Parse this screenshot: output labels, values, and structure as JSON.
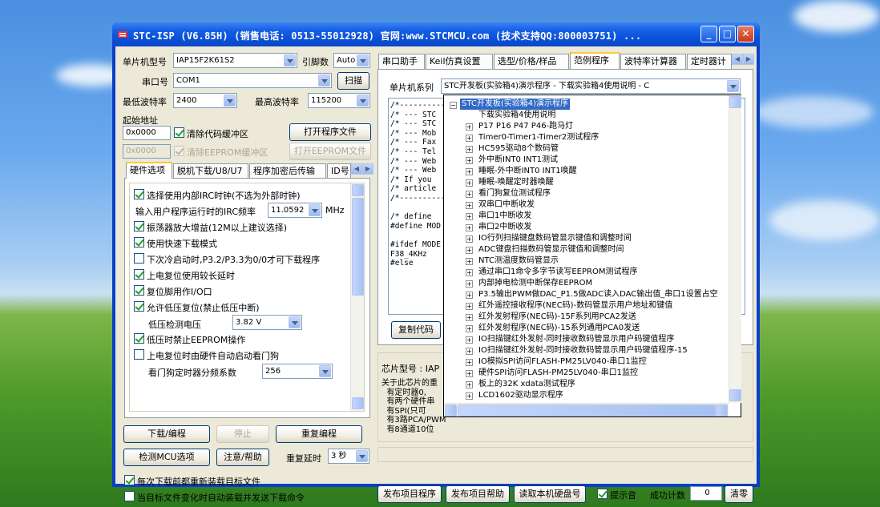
{
  "window": {
    "title": "STC-ISP (V6.85H) (销售电话: 0513-55012928) 官网:www.STCMCU.com  (技术支持QQ:800003751) ..."
  },
  "left": {
    "mcu_label": "单片机型号",
    "mcu_value": "IAP15F2K61S2",
    "pin_label": "引脚数",
    "pin_value": "Auto",
    "port_label": "串口号",
    "port_value": "COM1",
    "scan_button": "扫描",
    "min_baud_label": "最低波特率",
    "min_baud_value": "2400",
    "max_baud_label": "最高波特率",
    "max_baud_value": "115200",
    "start_addr_label": "起始地址",
    "addr1": "0x0000",
    "clear_code_label": "清除代码缓冲区",
    "open_prog_button": "打开程序文件",
    "addr2": "0x0000",
    "clear_eeprom_label": "清除EEPROM缓冲区",
    "open_eeprom_button": "打开EEPROM文件",
    "tabs": [
      "硬件选项",
      "脱机下载/U8/U7",
      "程序加密后传输",
      "ID号"
    ],
    "options": [
      {
        "label": "选择使用内部IRC时钟(不选为外部时钟)",
        "checked": true
      },
      {
        "label": "振荡器放大增益(12M以上建议选择)",
        "checked": true
      },
      {
        "label": "使用快速下载模式",
        "checked": true
      },
      {
        "label": "下次冷启动时,P3.2/P3.3为0/0才可下载程序",
        "checked": false
      },
      {
        "label": "上电复位使用较长延时",
        "checked": true
      },
      {
        "label": "复位脚用作I/O口",
        "checked": true
      },
      {
        "label": "允许低压复位(禁止低压中断)",
        "checked": true
      },
      {
        "label": "低压时禁止EEPROM操作",
        "checked": true
      },
      {
        "label": "上电复位时由硬件自动启动看门狗",
        "checked": false
      }
    ],
    "irc_label": "输入用户程序运行时的IRC频率",
    "irc_value": "11.0592",
    "irc_unit": "MHz",
    "lv_label": "低压检测电压",
    "lv_value": "3.82 V",
    "wd_label": "看门狗定时器分频系数",
    "wd_value": "256",
    "download_button": "下载/编程",
    "stop_button": "停止",
    "reprogram_button": "重复编程",
    "detect_button": "检测MCU选项",
    "help_button": "注意/帮助",
    "delay_label": "重复延时",
    "delay_value": "3 秒",
    "reload_label": "每次下载前都重新装载目标文件",
    "reload_checked": true,
    "autoload_label": "当目标文件变化时自动装载并发送下载命令",
    "autoload_checked": false
  },
  "right": {
    "tabs": [
      "串口助手",
      "Keil仿真设置",
      "选型/价格/样品",
      "范例程序",
      "波特率计算器",
      "定时器计"
    ],
    "series_label": "单片机系列",
    "series_value": "STC开发板(实验箱4)演示程序 - 下载实验箱4使用说明 - C",
    "code_lines": [
      "/*------------",
      "/* --- STC",
      "/* --- STC",
      "/* --- Mob",
      "/* --- Fax",
      "/* --- Tel",
      "/* --- Web",
      "/* --- Web",
      "/* If you",
      "/* article",
      "/*----------",
      "",
      "/* define",
      "#define MOD",
      "",
      "#ifdef MODE",
      "F38_4KHz",
      "#else"
    ],
    "copy_button": "复制代码",
    "chip_label": "芯片型号 : IAP",
    "info_lines": [
      "关于此芯片的重",
      "  有定时器0,",
      "  有两个硬件串",
      "  有SPI(只可",
      "  有3路PCA/PWM",
      "  有8通道10位"
    ],
    "publish_button": "发布项目程序",
    "publish_help_button": "发布项目帮助",
    "read_disk_button": "读取本机硬盘号",
    "sound_label": "提示音",
    "sound_checked": true,
    "count_label": "成功计数",
    "count_value": "0",
    "clear_button": "清零"
  },
  "dropdown": {
    "root": "STC开发板(实验箱4)演示程序",
    "first_child": "下载实验箱4使用说明",
    "items": [
      "P17 P16 P47 P46-跑马灯",
      "Timer0-Timer1-Timer2测试程序",
      "HC595驱动8个数码管",
      "外中断INT0 INT1测试",
      "睡眠-外中断INT0 INT1唤醒",
      "睡眠-唤醒定时器唤醒",
      "看门狗复位测试程序",
      "双串口中断收发",
      "串口1中断收发",
      "串口2中断收发",
      "IO行列扫描键盘数码管显示键值和调整时间",
      "ADC键盘扫描数码管显示键值和调整时间",
      "NTC测温度数码管显示",
      "通过串口1命令多字节读写EEPROM测试程序",
      "内部掉电检测中断保存EEPROM",
      "P3.5输出PWM做DAC_P1.5做ADC读入DAC输出值_串口1设置占空",
      "红外遥控接收程序(NEC码)-数码管显示用户地址和键值",
      "红外发射程序(NEC码)-15F系列用PCA2发送",
      "红外发射程序(NEC码)-15系列通用PCA0发送",
      "IO扫描键红外发射-同时接收数码管显示用户码键值程序",
      "IO扫描键红外发射-同时接收数码管显示用户码键值程序-15",
      "IO模拟SPI访问FLASH-PM25LV040-串口1监控",
      "硬件SPI访问FLASH-PM25LV040-串口1监控",
      "板上的32K xdata测试程序",
      "LCD1602驱动显示程序"
    ]
  }
}
